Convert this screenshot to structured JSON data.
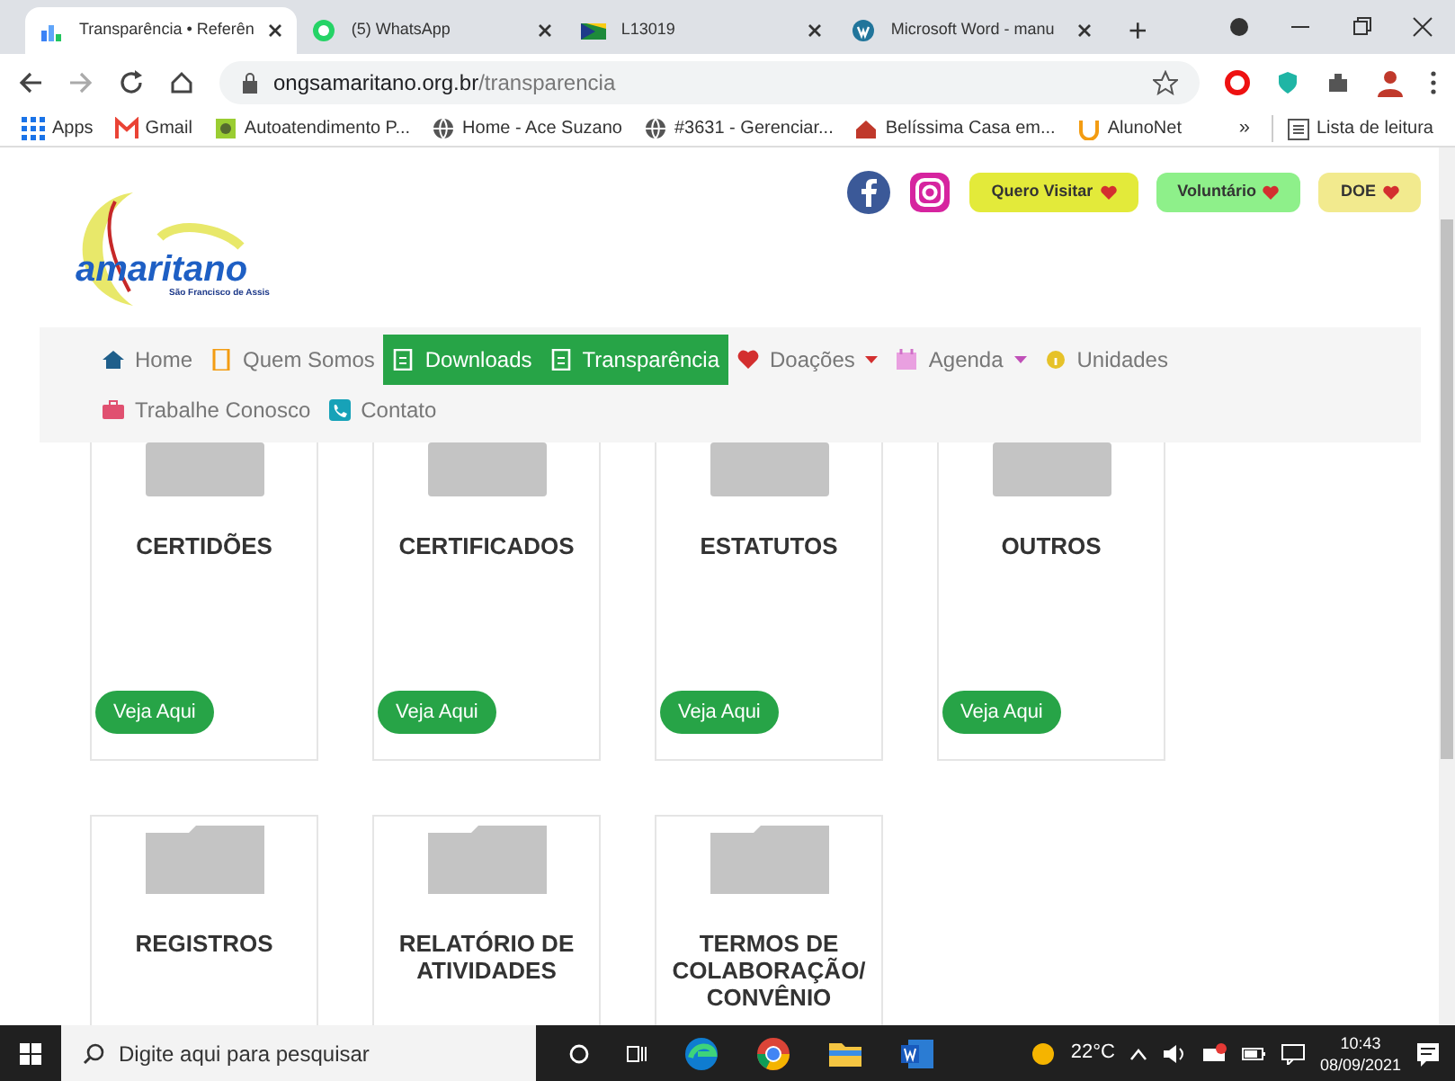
{
  "browser": {
    "tabs": [
      {
        "title": "Transparência • Referên",
        "selected": true
      },
      {
        "title": "(5) WhatsApp",
        "selected": false
      },
      {
        "title": "L13019",
        "selected": false
      },
      {
        "title": "Microsoft Word - manu",
        "selected": false
      }
    ],
    "new_tab": "+",
    "address": {
      "host": "ongsamaritano.org.br",
      "path": "/transparencia"
    },
    "bookmarks": [
      {
        "label": "Apps"
      },
      {
        "label": "Gmail"
      },
      {
        "label": "Autoatendimento P..."
      },
      {
        "label": "Home - Ace Suzano"
      },
      {
        "label": "#3631 - Gerenciar..."
      },
      {
        "label": "Belíssima Casa em..."
      },
      {
        "label": "AlunoNet"
      }
    ],
    "overflow": "»",
    "reading_list": "Lista de leitura"
  },
  "site": {
    "logo": {
      "name": "amaritano",
      "tagline": "São Francisco de Assis"
    },
    "header_buttons": [
      {
        "label": "Quero Visitar",
        "color": "#e3ea3a"
      },
      {
        "label": "Voluntário",
        "color": "#8ef08a"
      },
      {
        "label": "DOE",
        "color": "#f2ea8e"
      }
    ],
    "nav": [
      {
        "label": "Home",
        "active": false,
        "dropdown": false
      },
      {
        "label": "Quem Somos",
        "active": false,
        "dropdown": false
      },
      {
        "label": "Downloads",
        "active": true,
        "dropdown": false
      },
      {
        "label": "Transparência",
        "active": true,
        "dropdown": false
      },
      {
        "label": "Doações",
        "active": false,
        "dropdown": true
      },
      {
        "label": "Agenda",
        "active": false,
        "dropdown": true
      },
      {
        "label": "Unidades",
        "active": false,
        "dropdown": false
      },
      {
        "label": "Trabalhe Conosco",
        "active": false,
        "dropdown": false
      },
      {
        "label": "Contato",
        "active": false,
        "dropdown": false
      }
    ],
    "cards": [
      {
        "title": "CERTIDÕES",
        "button": "Veja Aqui"
      },
      {
        "title": "CERTIFICADOS",
        "button": "Veja Aqui"
      },
      {
        "title": "ESTATUTOS",
        "button": "Veja Aqui"
      },
      {
        "title": "OUTROS",
        "button": "Veja Aqui"
      },
      {
        "title": "REGISTROS"
      },
      {
        "title": "RELATÓRIO DE ATIVIDADES"
      },
      {
        "title": "TERMOS DE COLABORAÇÃO/ CONVÊNIO"
      }
    ]
  },
  "taskbar": {
    "search_placeholder": "Digite aqui para pesquisar",
    "temperature": "22°C",
    "time": "10:43",
    "date": "08/09/2021"
  }
}
